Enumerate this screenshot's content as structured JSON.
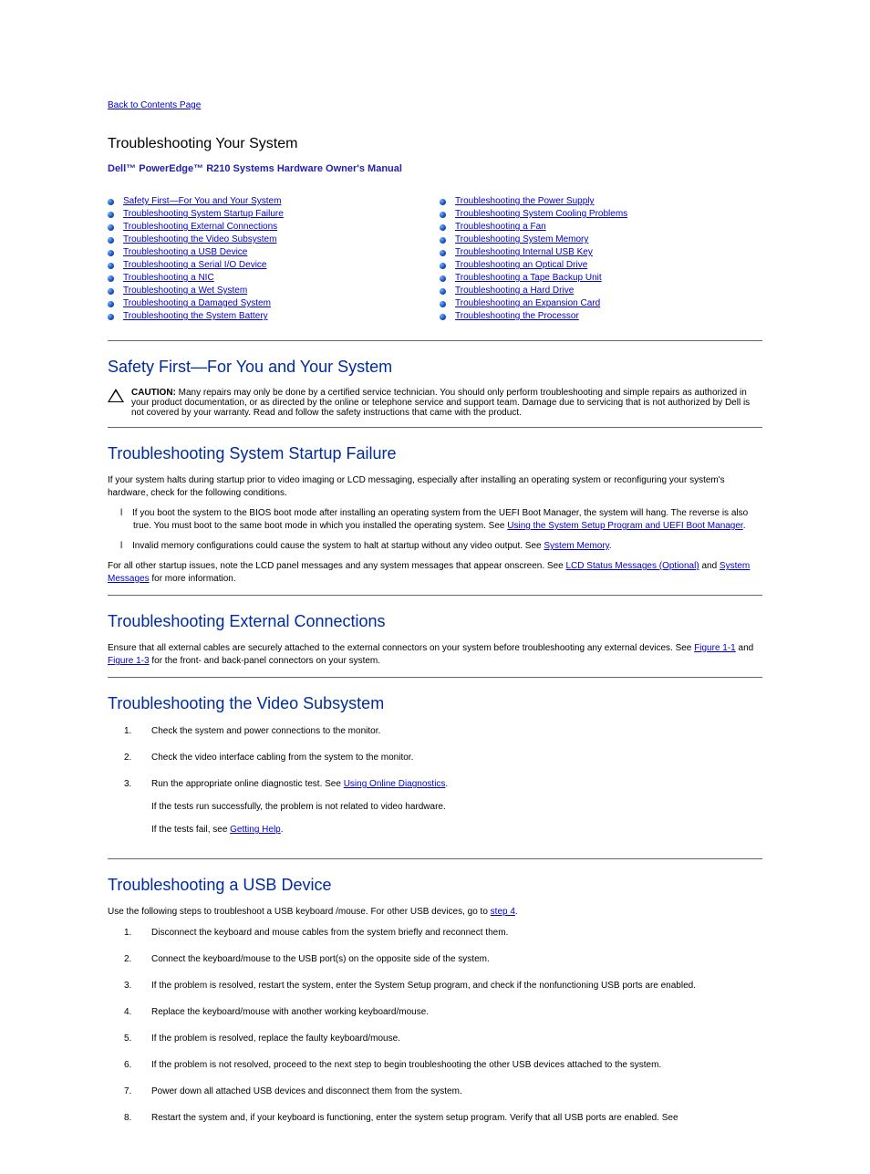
{
  "back_link": "Back to Contents Page",
  "page_title": "Troubleshooting Your System",
  "manual_title": "Dell™ PowerEdge™ R210 Systems Hardware Owner's Manual",
  "toc": {
    "left": [
      "Safety First—For You and Your System",
      "Troubleshooting System Startup Failure",
      "Troubleshooting External Connections",
      "Troubleshooting the Video Subsystem",
      "Troubleshooting a USB Device",
      "Troubleshooting a Serial I/O Device",
      "Troubleshooting a NIC",
      "Troubleshooting a Wet System",
      "Troubleshooting a Damaged System",
      "Troubleshooting the System Battery"
    ],
    "right": [
      "Troubleshooting the Power Supply",
      "Troubleshooting System Cooling Problems",
      "Troubleshooting a Fan",
      "Troubleshooting System Memory",
      "Troubleshooting Internal USB Key",
      "Troubleshooting an Optical Drive",
      "Troubleshooting a Tape Backup Unit",
      "Troubleshooting a Hard Drive",
      "Troubleshooting an Expansion Card",
      "Troubleshooting the Processor"
    ]
  },
  "safety": {
    "heading": "Safety First—For You and Your System",
    "caution_label": "CAUTION:",
    "caution_text": " Many repairs may only be done by a certified service technician. You should only perform troubleshooting and simple repairs as authorized in your product documentation, or as directed by the online or telephone service and support team. Damage due to servicing that is not authorized by Dell is not covered by your warranty. Read and follow the safety instructions that came with the product."
  },
  "startup": {
    "heading": "Troubleshooting System Startup Failure",
    "p1a": "If your system halts during startup prior to video imaging or LCD messaging, especially after installing an operating system or reconfiguring your system's hardware, check for the following conditions.",
    "li1a": "If you boot the system to the BIOS boot mode after installing an operating system from the UEFI Boot Manager, the system will hang. The reverse is also true. You must boot to the same boot mode in which you installed the operating system. See ",
    "li1_link": "Using the System Setup Program and UEFI Boot Manager",
    "li1b": ".",
    "li2a": "Invalid memory configurations could cause the system to halt at startup without any video output. See ",
    "li2_link": "System Memory",
    "li2b": ".",
    "p2a": "For all other startup issues, note the LCD panel messages and any system messages that appear onscreen. See ",
    "p2_link1": "LCD Status Messages (Optional)",
    "p2_mid": " and ",
    "p2_link2": "System Messages",
    "p2b": " for more information."
  },
  "external": {
    "heading": "Troubleshooting External Connections",
    "p1a": "Ensure that all external cables are securely attached to the external connectors on your system before troubleshooting any external devices. See ",
    "p1_link1": "Figure 1-1",
    "p1_mid": " and ",
    "p1_link2": "Figure 1-3",
    "p1b": " for the front- and back-panel connectors on your system."
  },
  "video": {
    "heading": "Troubleshooting the Video Subsystem",
    "steps": [
      {
        "n": "1.",
        "text": "Check the system and power connections to the monitor."
      },
      {
        "n": "2.",
        "text": "Check the video interface cabling from the system to the monitor."
      },
      {
        "n": "3.",
        "text_a": "Run the appropriate online diagnostic test. See ",
        "link": "Using Online Diagnostics",
        "text_b": ".",
        "sub_ok": "If the tests run successfully, the problem is not related to video hardware.",
        "sub_fail_a": "If the tests fail, see ",
        "sub_fail_link": "Getting Help",
        "sub_fail_b": "."
      }
    ]
  },
  "usb": {
    "heading": "Troubleshooting a USB Device",
    "intro_a": "Use the following steps to troubleshoot a USB keyboard /mouse. For other USB devices, go to ",
    "intro_link": "step 4",
    "intro_b": ".",
    "steps": [
      {
        "n": "1.",
        "text": "Disconnect the keyboard and mouse cables from the system briefly and reconnect them."
      },
      {
        "n": "2.",
        "text": "Connect the keyboard/mouse to the USB port(s) on the opposite side of the system."
      },
      {
        "n": "3.",
        "text_a": "If the problem is resolved, restart the system, enter the System Setup program, and check if the nonfunctioning USB ports are enabled."
      },
      {
        "n": "4.",
        "text": "Replace the keyboard/mouse with another working keyboard/mouse."
      },
      {
        "n": "5.",
        "text": "If the problem is resolved, replace the faulty keyboard/mouse."
      },
      {
        "n": "6.",
        "text": "If the problem is not resolved, proceed to the next step to begin troubleshooting the other USB devices attached to the system."
      },
      {
        "n": "7.",
        "text": "Power down all attached USB devices and disconnect them from the system."
      },
      {
        "n": "8.",
        "text": "Restart the system and, if your keyboard is functioning, enter the system setup program. Verify that all USB ports are enabled. See"
      }
    ]
  }
}
